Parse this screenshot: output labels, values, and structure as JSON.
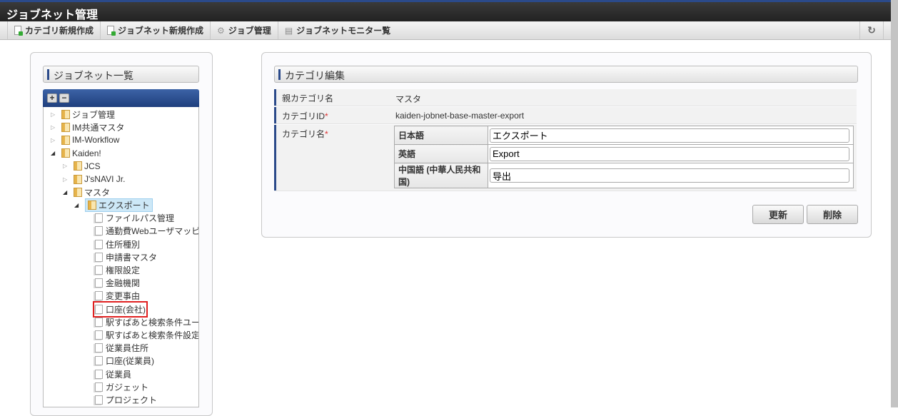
{
  "app": {
    "title": "ジョブネット管理"
  },
  "toolbar": {
    "items": [
      {
        "label": "カテゴリ新規作成",
        "icon": "new-doc-icon"
      },
      {
        "label": "ジョブネット新規作成",
        "icon": "new-doc-icon"
      },
      {
        "label": "ジョブ管理",
        "icon": "gear-icon"
      },
      {
        "label": "ジョブネットモニター覧",
        "icon": "list-icon"
      }
    ],
    "refresh_icon": "refresh-icon"
  },
  "left": {
    "title": "ジョブネット一覧",
    "expand": "+",
    "collapse": "−",
    "tree": [
      {
        "label": "ジョブ管理",
        "level": 0,
        "type": "folder",
        "state": "closed"
      },
      {
        "label": "IM共通マスタ",
        "level": 0,
        "type": "folder",
        "state": "closed"
      },
      {
        "label": "IM-Workflow",
        "level": 0,
        "type": "folder",
        "state": "closed"
      },
      {
        "label": "Kaiden!",
        "level": 0,
        "type": "folder",
        "state": "open"
      },
      {
        "label": "JCS",
        "level": 1,
        "type": "folder",
        "state": "closed"
      },
      {
        "label": "J'sNAVI Jr.",
        "level": 1,
        "type": "folder",
        "state": "closed"
      },
      {
        "label": "マスタ",
        "level": 1,
        "type": "folder",
        "state": "open"
      },
      {
        "label": "エクスポート",
        "level": 2,
        "type": "folder",
        "state": "open",
        "selected": true
      },
      {
        "label": "ファイルパス管理",
        "level": 3,
        "type": "file"
      },
      {
        "label": "通勤費Webユーザマッピング",
        "level": 3,
        "type": "file"
      },
      {
        "label": "住所種別",
        "level": 3,
        "type": "file"
      },
      {
        "label": "申請書マスタ",
        "level": 3,
        "type": "file"
      },
      {
        "label": "権限設定",
        "level": 3,
        "type": "file"
      },
      {
        "label": "金融機関",
        "level": 3,
        "type": "file"
      },
      {
        "label": "変更事由",
        "level": 3,
        "type": "file"
      },
      {
        "label": "口座(会社)",
        "level": 3,
        "type": "file",
        "highlighted": true
      },
      {
        "label": "駅すぱあと検索条件ユーザ",
        "level": 3,
        "type": "file"
      },
      {
        "label": "駅すぱあと検索条件設定",
        "level": 3,
        "type": "file"
      },
      {
        "label": "従業員住所",
        "level": 3,
        "type": "file"
      },
      {
        "label": "口座(従業員)",
        "level": 3,
        "type": "file"
      },
      {
        "label": "従業員",
        "level": 3,
        "type": "file"
      },
      {
        "label": "ガジェット",
        "level": 3,
        "type": "file"
      },
      {
        "label": "プロジェクト",
        "level": 3,
        "type": "file"
      }
    ]
  },
  "form": {
    "title": "カテゴリ編集",
    "parent_label": "親カテゴリ名",
    "parent_value": "マスタ",
    "id_label": "カテゴリID",
    "id_value": "kaiden-jobnet-base-master-export",
    "name_label": "カテゴリ名",
    "required": "*",
    "names": [
      {
        "lang": "日本語",
        "value": "エクスポート"
      },
      {
        "lang": "英語",
        "value": "Export"
      },
      {
        "lang": "中国語 (中華人民共和国)",
        "value": "导出"
      }
    ],
    "update": "更新",
    "delete": "削除"
  },
  "colors": {
    "accent": "#2b4a8a",
    "highlight": "#e02020"
  }
}
